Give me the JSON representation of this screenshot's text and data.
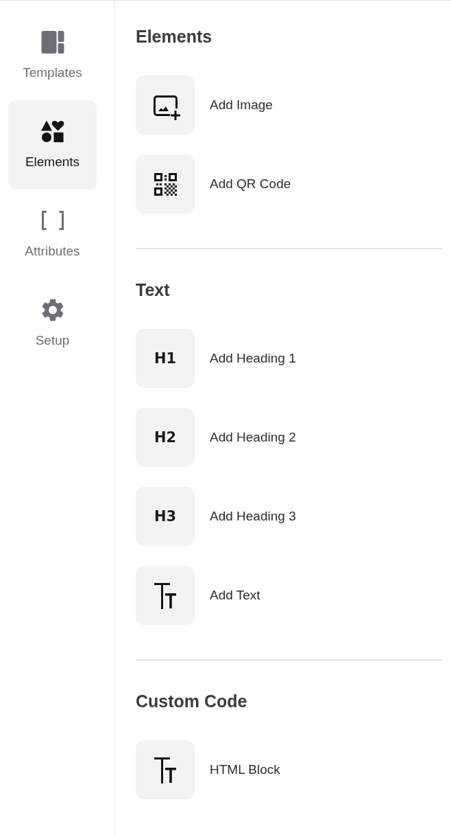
{
  "sidebar": {
    "items": [
      {
        "label": "Templates",
        "kind": "layout",
        "selected": false
      },
      {
        "label": "Elements",
        "kind": "shapes",
        "selected": true
      },
      {
        "label": "Attributes",
        "kind": "brackets",
        "selected": false
      },
      {
        "label": "Setup",
        "kind": "gear",
        "selected": false
      }
    ]
  },
  "sections": [
    {
      "title": "Elements",
      "items": [
        {
          "kind": "image",
          "label": "Add Image"
        },
        {
          "kind": "qr",
          "label": "Add QR Code"
        }
      ]
    },
    {
      "title": "Text",
      "items": [
        {
          "kind": "heading",
          "glyph": "H1",
          "label": "Add Heading 1"
        },
        {
          "kind": "heading",
          "glyph": "H2",
          "label": "Add Heading 2"
        },
        {
          "kind": "heading",
          "glyph": "H3",
          "label": "Add Heading 3"
        },
        {
          "kind": "text",
          "label": "Add Text"
        }
      ]
    },
    {
      "title": "Custom Code",
      "items": [
        {
          "kind": "text",
          "label": "HTML Block"
        }
      ]
    }
  ]
}
